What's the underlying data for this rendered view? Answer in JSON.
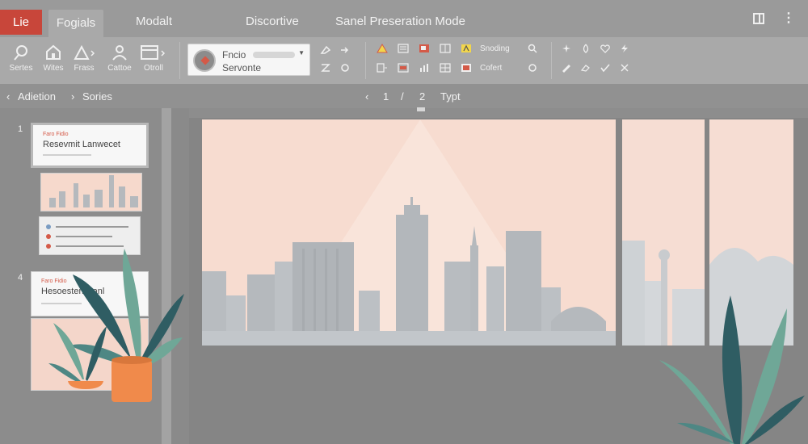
{
  "tabs": {
    "file": "Lie",
    "active": "Fogials",
    "t3": "Modalt",
    "t4": "Discortive",
    "t5": "Sanel Preseration Mode"
  },
  "ribbon": {
    "groups": [
      {
        "label": "Sertes",
        "icon": "search-icon"
      },
      {
        "label": "Wites",
        "icon": "home-icon"
      },
      {
        "label": "Frass",
        "icon": "shapes-icon"
      },
      {
        "label": "Cattoe",
        "icon": "person-icon"
      },
      {
        "label": "Otroll",
        "icon": "layout-icon"
      }
    ],
    "font_name": "Fncio",
    "font_sub": "Servonte",
    "mini_labels": [
      "Snoding",
      "Cofert"
    ]
  },
  "nav": {
    "crumb1": "Adietion",
    "crumb2": "Sories",
    "page_current": "1",
    "page_sep": "/",
    "page_total": "2",
    "page_label": "Typt"
  },
  "thumbs": {
    "num1": "1",
    "num4": "4",
    "t1_kicker": "Faro Fidio",
    "t1_title": "Resevmit Lanwecet",
    "t4_kicker": "Faro Fidio",
    "t4_title": "Hesoesten Canl"
  },
  "colors": {
    "accent": "#c8463a",
    "slide_bg": "#f7dcd0",
    "building": "#b5b9bd",
    "plant_dark": "#2f5d63",
    "plant_light": "#6fa797",
    "pot": "#f08a4b"
  }
}
